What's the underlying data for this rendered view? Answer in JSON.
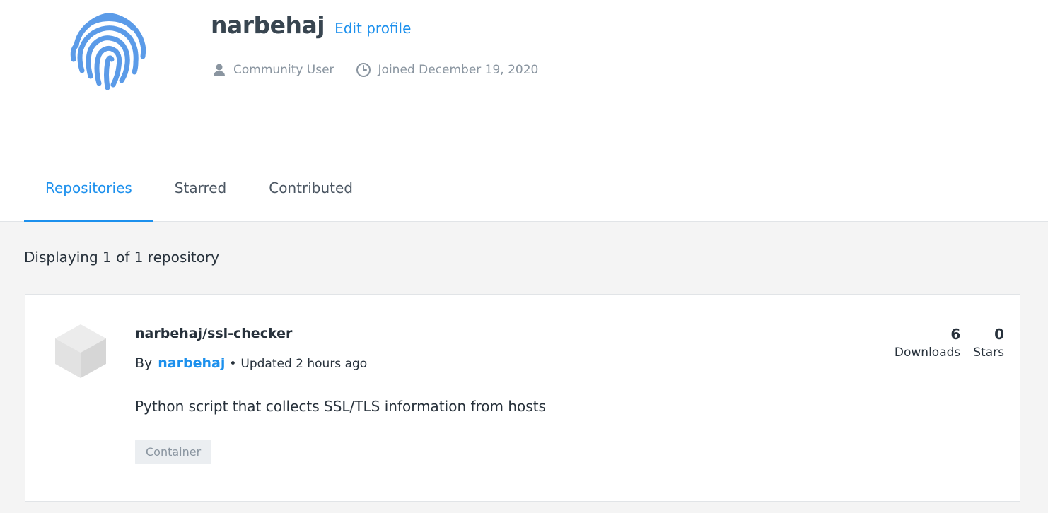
{
  "profile": {
    "username": "narbehaj",
    "edit_label": "Edit profile",
    "role": "Community User",
    "joined": "Joined December 19, 2020",
    "avatar_icon": "fingerprint-icon",
    "accent_color": "#1c90ed"
  },
  "tabs": [
    {
      "label": "Repositories",
      "active": true
    },
    {
      "label": "Starred",
      "active": false
    },
    {
      "label": "Contributed",
      "active": false
    }
  ],
  "listing": {
    "count_text": "Displaying 1 of 1 repository"
  },
  "repositories": [
    {
      "name": "narbehaj/ssl-checker",
      "by_prefix": "By",
      "owner": "narbehaj",
      "separator": "•",
      "updated": "Updated 2 hours ago",
      "description": "Python script that collects SSL/TLS information from hosts",
      "badge": "Container",
      "downloads": "6",
      "downloads_label": "Downloads",
      "stars": "0",
      "stars_label": "Stars",
      "icon": "cube-icon"
    }
  ]
}
